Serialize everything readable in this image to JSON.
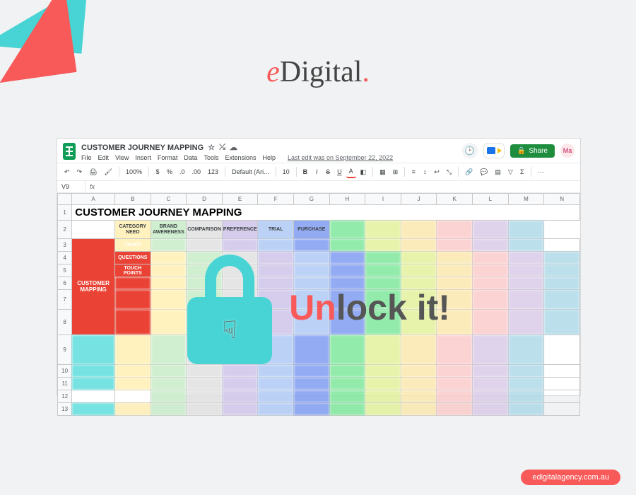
{
  "brand": {
    "e": "e",
    "rest": "Digital",
    "dot": "."
  },
  "doc": {
    "title": "CUSTOMER JOURNEY MAPPING",
    "star": "☆",
    "folder": "⤯",
    "cloud": "☁",
    "menus": [
      "File",
      "Edit",
      "View",
      "Insert",
      "Format",
      "Data",
      "Tools",
      "Extensions",
      "Help"
    ],
    "last_edit": "Last edit was on September 22, 2022",
    "share": "Share",
    "avatar": "Ma"
  },
  "toolbar": {
    "zoom": "100%",
    "currency": "$",
    "percent": "%",
    "dec_dec": ".0",
    "dec_inc": ".00",
    "numfmt": "123",
    "font": "Default (Ari...",
    "size": "10",
    "bold": "B",
    "italic": "I",
    "strike": "S",
    "under": "U",
    "textcolor": "A"
  },
  "fx": {
    "cell": "V9",
    "fx_label": "fx"
  },
  "columns": [
    "A",
    "B",
    "C",
    "D",
    "E",
    "F",
    "G",
    "H",
    "I",
    "J",
    "K",
    "L",
    "M",
    "N"
  ],
  "rows": [
    "1",
    "2",
    "3",
    "4",
    "5",
    "6",
    "7",
    "8",
    "9",
    "10",
    "11",
    "12",
    "13"
  ],
  "sheet": {
    "title": "CUSTOMER JOURNEY MAPPING",
    "stages": {
      "category": "CATEGORY NEED",
      "brand": "BRAND AWERENESS",
      "comparison": "COMPARISON",
      "preference": "PREFERENCE",
      "trial": "TRIAL",
      "purchase": "PURCHASE"
    },
    "row_labels": {
      "tasks": "TASKS",
      "questions": "QUESTIONS",
      "touch": "TOUCH POINTS"
    },
    "side_label": "CUSTOMER MAPPING"
  },
  "overlay": {
    "un": "Un",
    "rest": "lock it!"
  },
  "watermark": "edigitalagency.com.au"
}
